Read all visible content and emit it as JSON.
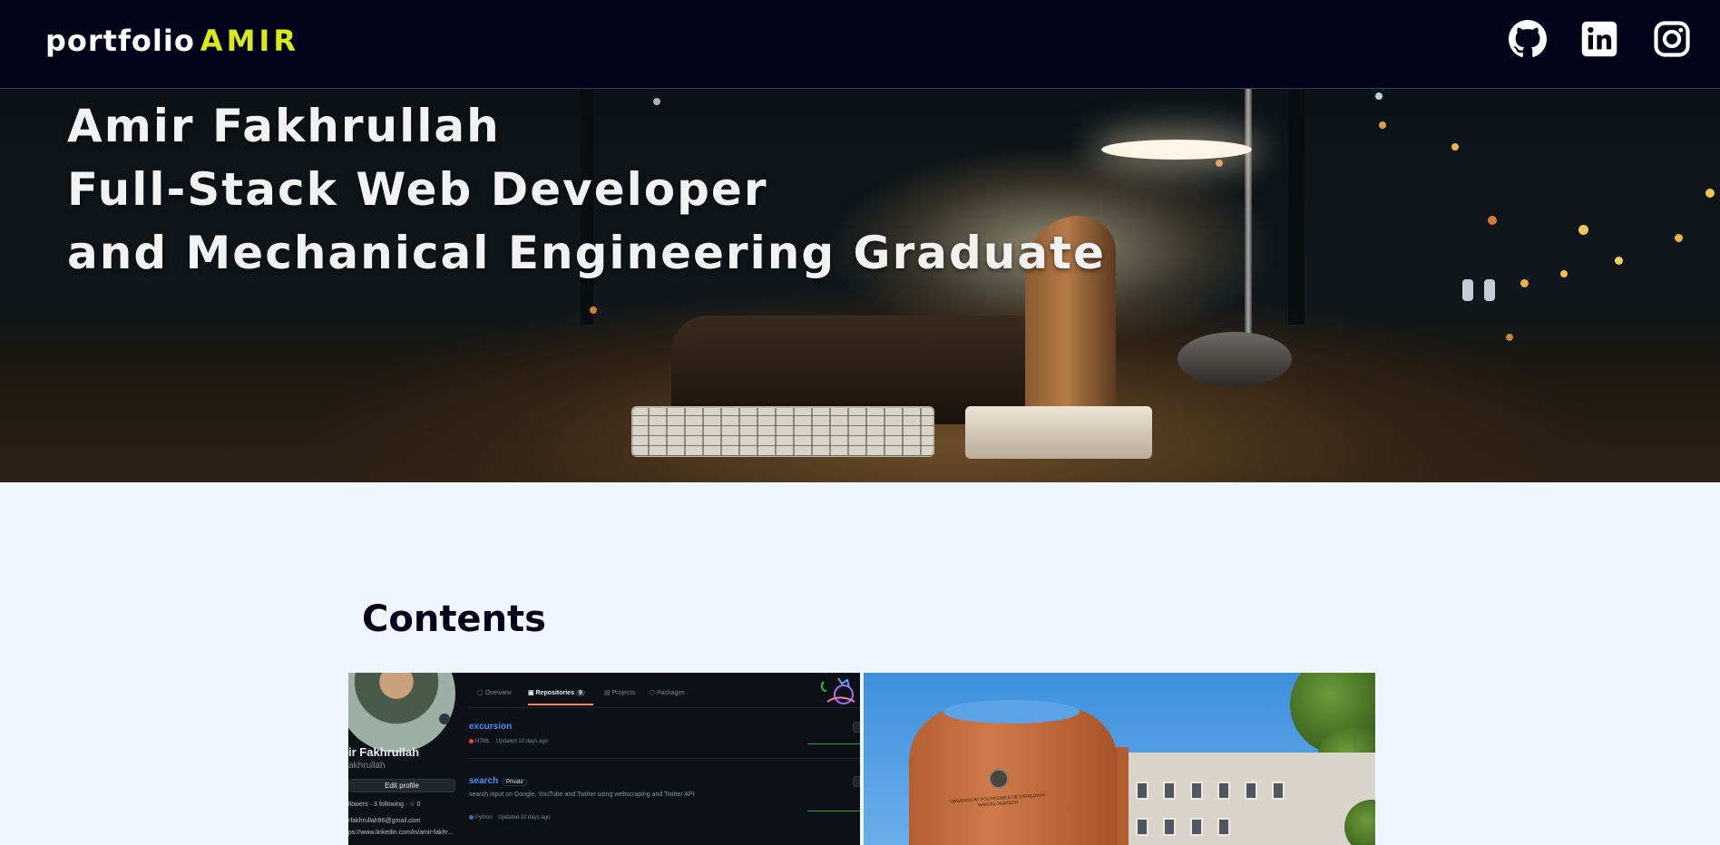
{
  "header": {
    "brand_prefix": "portfolio",
    "brand_name": "AMIR",
    "social": [
      {
        "name": "GitHub",
        "icon": "github-icon"
      },
      {
        "name": "LinkedIn",
        "icon": "linkedin-icon"
      },
      {
        "name": "Instagram",
        "icon": "instagram-icon"
      }
    ]
  },
  "hero": {
    "lines": [
      "Amir Fakhrullah",
      "Full-Stack Web Developer",
      "and Mechanical Engineering Graduate"
    ]
  },
  "contents": {
    "heading": "Contents",
    "cards": [
      {
        "name": "github-card",
        "profile_name": "ir Fakhrullah",
        "profile_user": "akhrullah",
        "edit_label": "Edit profile",
        "follow_text": "llowers · 3 following · ☆ 0",
        "email": "rfakhrullah96@gmail.com",
        "link": "ps://www.linkedin.com/in/amir-fakhr...",
        "tabs": [
          "Overview",
          "Repositories",
          "Projects",
          "Packages"
        ],
        "repo_count": "9",
        "repos": [
          {
            "name": "excursion",
            "language": "HTML",
            "updated": "Updated 10 days ago",
            "lang_color": "#e34c26"
          },
          {
            "name": "search",
            "badge": "Private",
            "description": "search input on Google, YouTube and Twitter using webscraping and Twitter API",
            "language": "Python",
            "updated": "Updated 10 days ago",
            "lang_color": "#3572A5"
          }
        ]
      },
      {
        "name": "university-card",
        "sign_text": "UNIVERSITAT POLITÈCNICA DE CATALUNYA BARCELONATECH"
      }
    ]
  },
  "colors": {
    "nav_bg": "#02021b",
    "accent": "#d9ea16",
    "page_bg": "#eff6fe"
  }
}
